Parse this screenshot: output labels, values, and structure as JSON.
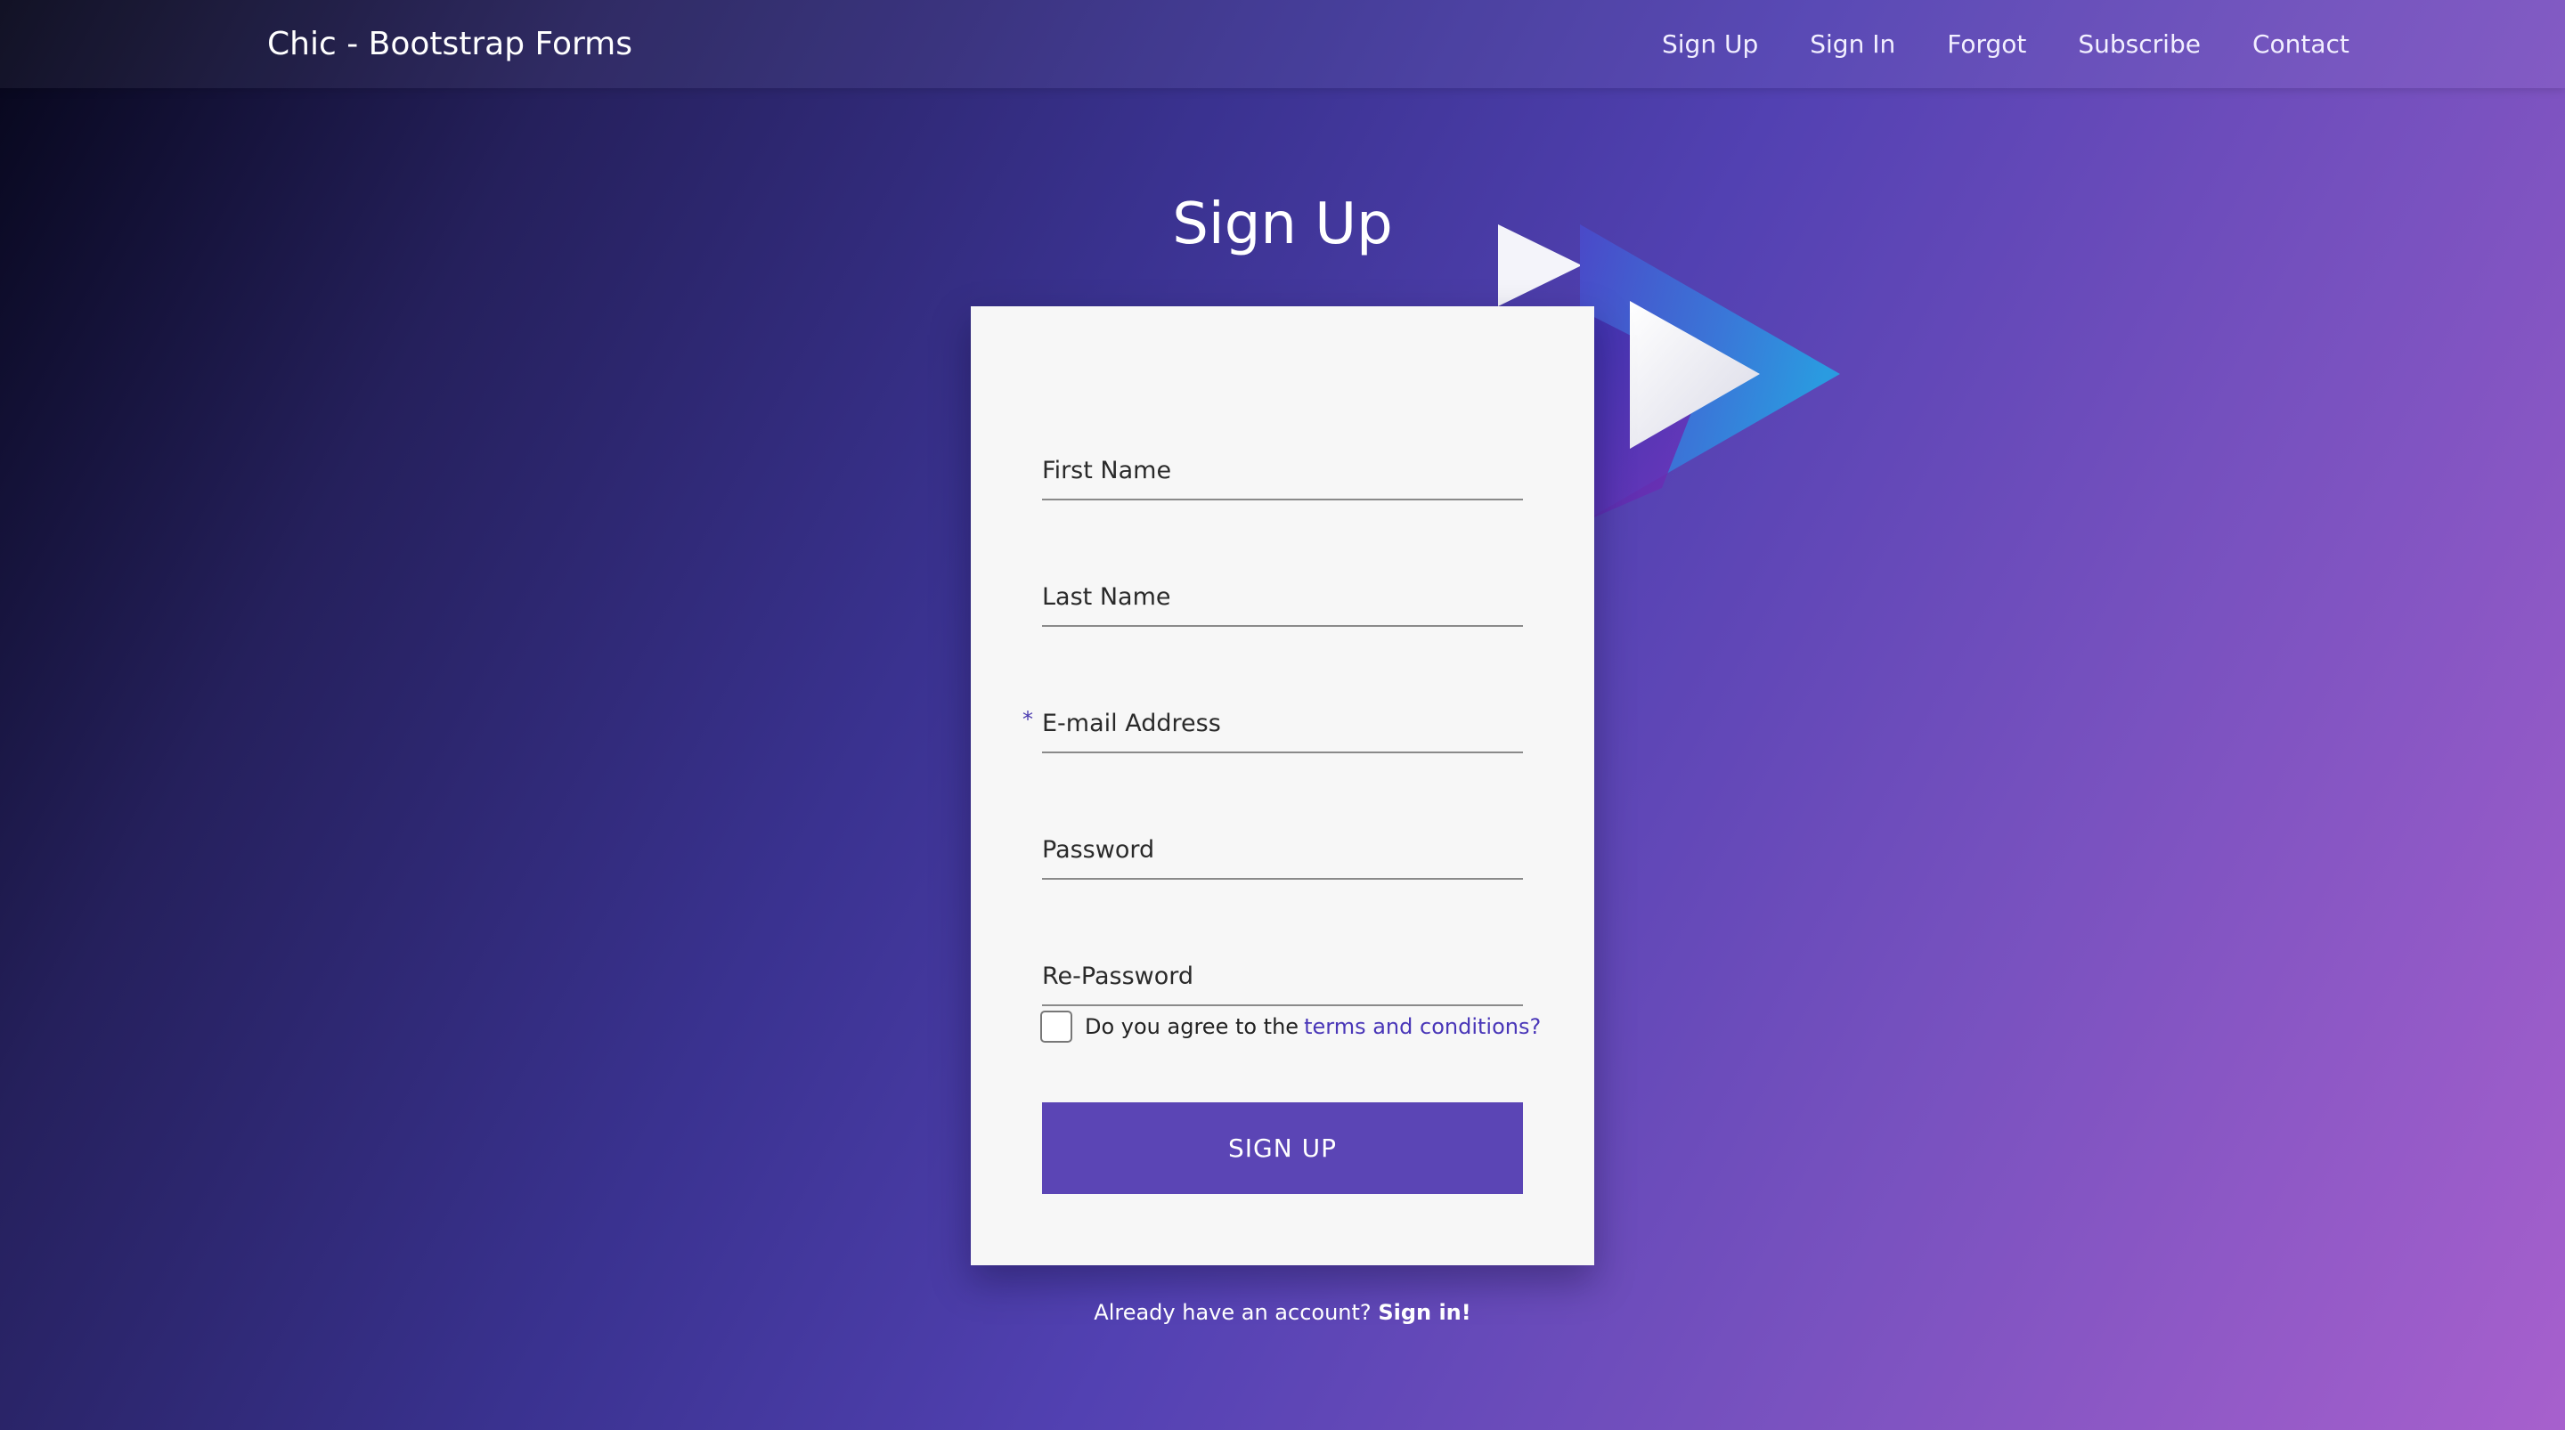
{
  "navbar": {
    "brand": "Chic - Bootstrap Forms",
    "links": [
      "Sign Up",
      "Sign In",
      "Forgot",
      "Subscribe",
      "Contact"
    ]
  },
  "page": {
    "title": "Sign Up"
  },
  "form": {
    "first_name_placeholder": "First Name",
    "last_name_placeholder": "Last Name",
    "email_placeholder": "E-mail Address",
    "email_required_mark": "*",
    "password_placeholder": "Password",
    "repassword_placeholder": "Re-Password",
    "terms_text": "Do you agree to the",
    "terms_link": "terms and conditions?",
    "terms_checked": false,
    "submit_label": "SIGN UP"
  },
  "footer": {
    "question": "Already have an account?",
    "link": "Sign in!"
  },
  "colors": {
    "accent": "#5b45b5",
    "link": "#4936b8",
    "card_background": "#f7f7f7"
  },
  "icons": {
    "decoration": "play-triangles-logo"
  }
}
